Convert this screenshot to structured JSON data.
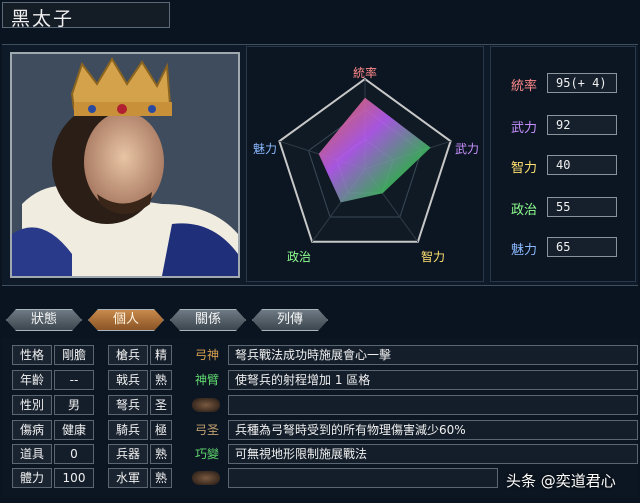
{
  "character": {
    "name": "黑太子"
  },
  "radar": {
    "labels": {
      "top": "統率",
      "right": "武力",
      "bottom_right": "智力",
      "bottom_left": "政治",
      "left": "魅力"
    },
    "values": {
      "leadership": 95,
      "war": 92,
      "intelligence": 40,
      "politics": 55,
      "charm": 65
    },
    "max": 120
  },
  "stats": [
    {
      "label": "統率",
      "value": "95(+ 4)",
      "color": "#ff8a8a"
    },
    {
      "label": "武力",
      "value": "92",
      "color": "#c890ff"
    },
    {
      "label": "智力",
      "value": "40",
      "color": "#ffe070"
    },
    {
      "label": "政治",
      "value": "55",
      "color": "#90ff90"
    },
    {
      "label": "魅力",
      "value": "65",
      "color": "#8ab8ff"
    }
  ],
  "tabs": [
    "狀態",
    "個人",
    "關係",
    "列傳"
  ],
  "profile": [
    {
      "label": "性格",
      "value": "剛膽"
    },
    {
      "label": "年齡",
      "value": "--"
    },
    {
      "label": "性別",
      "value": "男"
    },
    {
      "label": "傷病",
      "value": "健康"
    },
    {
      "label": "道具",
      "value": "0"
    },
    {
      "label": "體力",
      "value": "100"
    }
  ],
  "troops": [
    {
      "label": "槍兵",
      "value": "精"
    },
    {
      "label": "戟兵",
      "value": "熟"
    },
    {
      "label": "弩兵",
      "value": "圣"
    },
    {
      "label": "騎兵",
      "value": "極"
    },
    {
      "label": "兵器",
      "value": "熟"
    },
    {
      "label": "水軍",
      "value": "熟"
    }
  ],
  "skills": [
    {
      "icon": "弓神",
      "icon_color": "#d8a050",
      "desc": "弩兵戰法成功時施展會心一擊"
    },
    {
      "icon": "神臂",
      "icon_color": "#60d870",
      "desc": "使弩兵的射程增加 1 區格"
    },
    {
      "icon": "",
      "icon_color": "",
      "desc": ""
    },
    {
      "icon": "弓圣",
      "icon_color": "#c0a070",
      "desc": "兵種為弓弩時受到的所有物理傷害減少60%"
    },
    {
      "icon": "巧變",
      "icon_color": "#60d870",
      "desc": "可無視地形限制施展戰法"
    },
    {
      "icon": "",
      "icon_color": "",
      "desc": ""
    }
  ],
  "watermark": "头条 @奕道君心"
}
